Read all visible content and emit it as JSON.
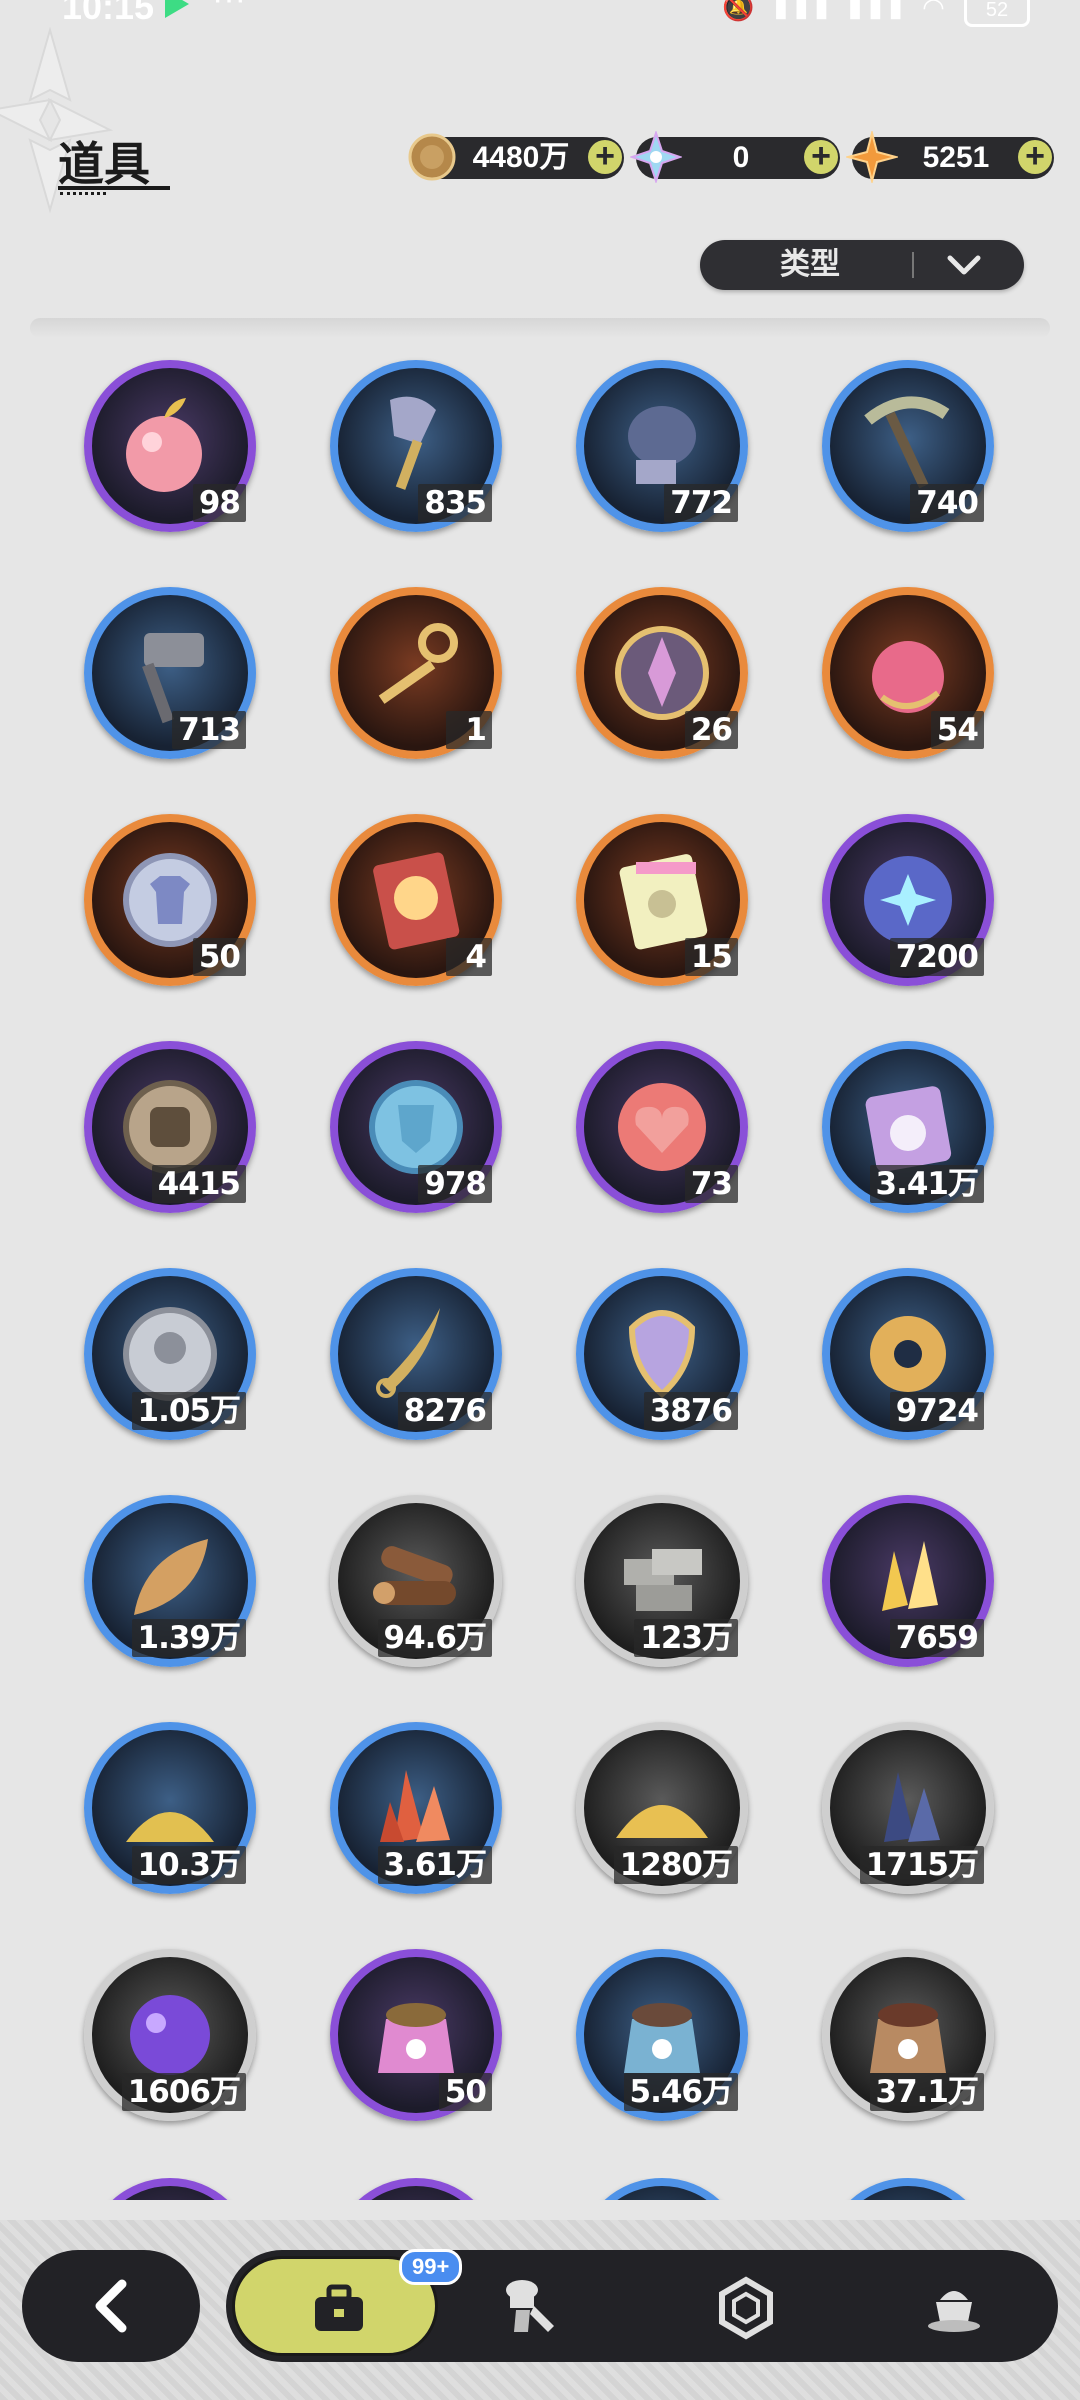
{
  "status_bar": {
    "time": "10:15",
    "battery": "52"
  },
  "header": {
    "title": "道具"
  },
  "currencies": [
    {
      "name": "coin",
      "value": "4480万",
      "color": "#c59b52"
    },
    {
      "name": "crystal",
      "value": "0",
      "color": "#9fd8f2"
    },
    {
      "name": "star-gem",
      "value": "5251",
      "color": "#f29a3c"
    }
  ],
  "filter": {
    "label": "类型"
  },
  "items": [
    {
      "icon": "apple-icon",
      "rarity": "purple",
      "count": "98"
    },
    {
      "icon": "shovel-icon",
      "rarity": "blue",
      "count": "835"
    },
    {
      "icon": "glove-icon",
      "rarity": "blue",
      "count": "772"
    },
    {
      "icon": "pickaxe-icon",
      "rarity": "blue",
      "count": "740"
    },
    {
      "icon": "hammer-icon",
      "rarity": "blue",
      "count": "713"
    },
    {
      "icon": "key-icon",
      "rarity": "orange",
      "count": "1"
    },
    {
      "icon": "emblem-icon",
      "rarity": "orange",
      "count": "26"
    },
    {
      "icon": "golden-apple-icon",
      "rarity": "orange",
      "count": "54"
    },
    {
      "icon": "shirt-coin-icon",
      "rarity": "orange",
      "count": "50"
    },
    {
      "icon": "wheel-ticket-icon",
      "rarity": "orange",
      "count": "4"
    },
    {
      "icon": "puzzle-ticket-icon",
      "rarity": "orange",
      "count": "15"
    },
    {
      "icon": "star-orb-icon",
      "rarity": "purple",
      "count": "7200"
    },
    {
      "icon": "fist-coin-icon",
      "rarity": "purple",
      "count": "4415"
    },
    {
      "icon": "shield-coin-icon",
      "rarity": "purple",
      "count": "978"
    },
    {
      "icon": "heart-coin-icon",
      "rarity": "purple",
      "count": "73"
    },
    {
      "icon": "bunny-card-icon",
      "rarity": "blue",
      "count": "3.41万"
    },
    {
      "icon": "silver-coin-icon",
      "rarity": "blue",
      "count": "1.05万"
    },
    {
      "icon": "blade-icon",
      "rarity": "blue",
      "count": "8276"
    },
    {
      "icon": "scale-icon",
      "rarity": "blue",
      "count": "3876"
    },
    {
      "icon": "gear-icon",
      "rarity": "blue",
      "count": "9724"
    },
    {
      "icon": "leaf-icon",
      "rarity": "blue",
      "count": "1.39万"
    },
    {
      "icon": "wood-logs-icon",
      "rarity": "gray",
      "count": "94.6万"
    },
    {
      "icon": "stone-bricks-icon",
      "rarity": "gray",
      "count": "123万"
    },
    {
      "icon": "gold-crystal-icon",
      "rarity": "purple",
      "count": "7659"
    },
    {
      "icon": "gold-dust-icon",
      "rarity": "blue",
      "count": "10.3万"
    },
    {
      "icon": "red-crystal-icon",
      "rarity": "blue",
      "count": "3.61万"
    },
    {
      "icon": "sand-pile-icon",
      "rarity": "gray",
      "count": "1280万"
    },
    {
      "icon": "dark-crystal-icon",
      "rarity": "gray",
      "count": "1715万"
    },
    {
      "icon": "purple-orb-icon",
      "rarity": "gray",
      "count": "1606万"
    },
    {
      "icon": "pink-bag-icon",
      "rarity": "purple",
      "count": "50"
    },
    {
      "icon": "blue-bag-icon",
      "rarity": "blue",
      "count": "5.46万"
    },
    {
      "icon": "brown-bag-icon",
      "rarity": "gray",
      "count": "37.1万"
    }
  ],
  "bottom_nav": {
    "badge": "99+",
    "tabs": [
      "bag-icon",
      "chef-knife-icon",
      "hexagon-icon",
      "pudding-icon"
    ]
  }
}
